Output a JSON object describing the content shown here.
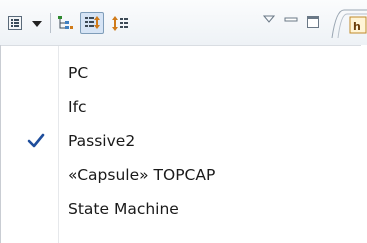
{
  "toolbar": {
    "icons": [
      "view-menu-icon",
      "dropdown-arrow-icon",
      "hierarchy-icon",
      "sort-expand-icon",
      "sort-order-icon",
      "minimize-arrow-icon",
      "minimize-icon",
      "maximize-icon",
      "editor-tab-icon"
    ]
  },
  "menu": {
    "items": [
      {
        "label": "PC",
        "checked": false
      },
      {
        "label": "Ifc",
        "checked": false
      },
      {
        "label": "Passive2",
        "checked": true
      },
      {
        "label": "«Capsule» TOPCAP",
        "checked": false
      },
      {
        "label": "State Machine",
        "checked": false
      }
    ],
    "check_color": "#1f4e9c"
  }
}
